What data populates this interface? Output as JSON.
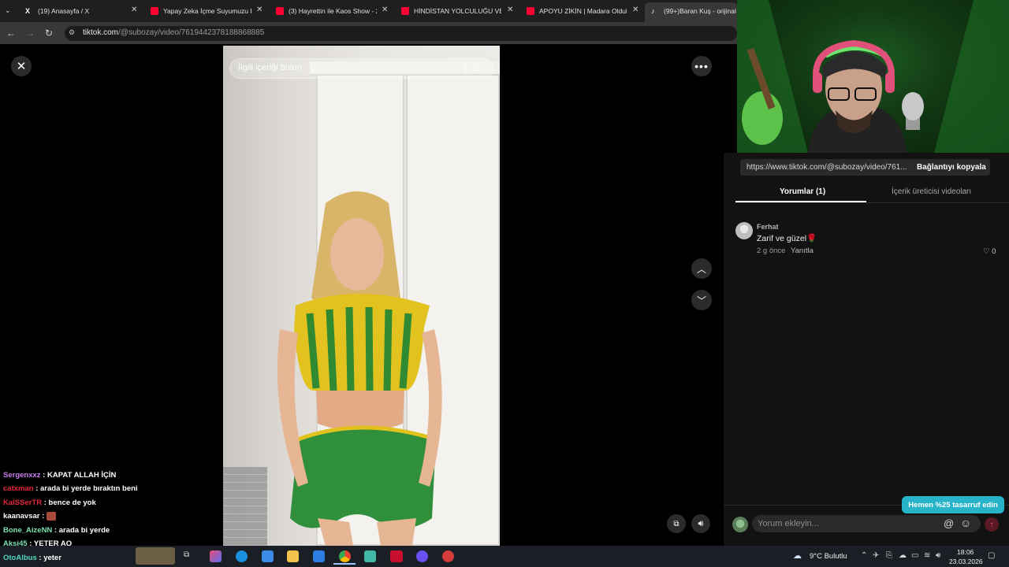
{
  "browser": {
    "tabs": [
      {
        "title": "(19) Anasayfa / X",
        "icon": "x-icon",
        "color": "#ffffff"
      },
      {
        "title": "Yapay Zeka İçme Suyumuzu Bit",
        "icon": "youtube-icon",
        "color": "#ff0033"
      },
      {
        "title": "(3) Hayrettin ile Kaos Show - 2.",
        "icon": "youtube-icon",
        "color": "#ff0033"
      },
      {
        "title": "HİNDİSTAN YOLCULUĞU VE Hİ",
        "icon": "youtube-icon",
        "color": "#ff0033"
      },
      {
        "title": "APOYU ZİKİN | Madara Olduk #",
        "icon": "youtube-icon",
        "color": "#ff0033"
      },
      {
        "title": "(99+)Baran Kuş - orijinal se",
        "icon": "tiktok-icon",
        "color": "#ffffff"
      }
    ],
    "url": {
      "domain": "tiktok.com",
      "path": "/@subozay/video/7619442378188868885"
    }
  },
  "video": {
    "search_placeholder": "İlgili içeriği bulun"
  },
  "chat": [
    {
      "user": "Sergenxxz",
      "color": "#c97cf0",
      "message": " : KAPAT ALLAH İÇİN"
    },
    {
      "user": "catxman",
      "color": "#e8253a",
      "message": " : arada bi yerde bıraktın beni"
    },
    {
      "user": "KalSSerTR",
      "color": "#e8253a",
      "message": " : bence de yok"
    },
    {
      "user": "kaanavsar",
      "color": "#ffffff",
      "message": " : "
    },
    {
      "user": "Bone_AizeNN",
      "color": "#7be3b0",
      "message": " : arada bi yerde"
    },
    {
      "user": "Aksi45",
      "color": "#7be3b0",
      "message": " : YETER AQ"
    },
    {
      "user": "OtoAlbus",
      "color": "#4fd7c2",
      "message": " : yeter"
    }
  ],
  "panel": {
    "share_url": "https://www.tiktok.com/@subozay/video/761...",
    "copy_link": "Bağlantıyı kopyala",
    "tab_comments": "Yorumlar (1)",
    "tab_creator_videos": "İçerik üreticisi videoları",
    "comment": {
      "user": "Ferhat",
      "text": "Zarif ve güzel🌹",
      "time": "2 g önce",
      "reply": "Yanıtla",
      "likes": "0"
    },
    "promo": "Hemen %25 tasarruf edin",
    "comment_placeholder": "Yorum ekleyin..."
  },
  "taskbar": {
    "weather": "9°C  Bulutlu",
    "time": "18:06",
    "date": "23.03.2026"
  }
}
